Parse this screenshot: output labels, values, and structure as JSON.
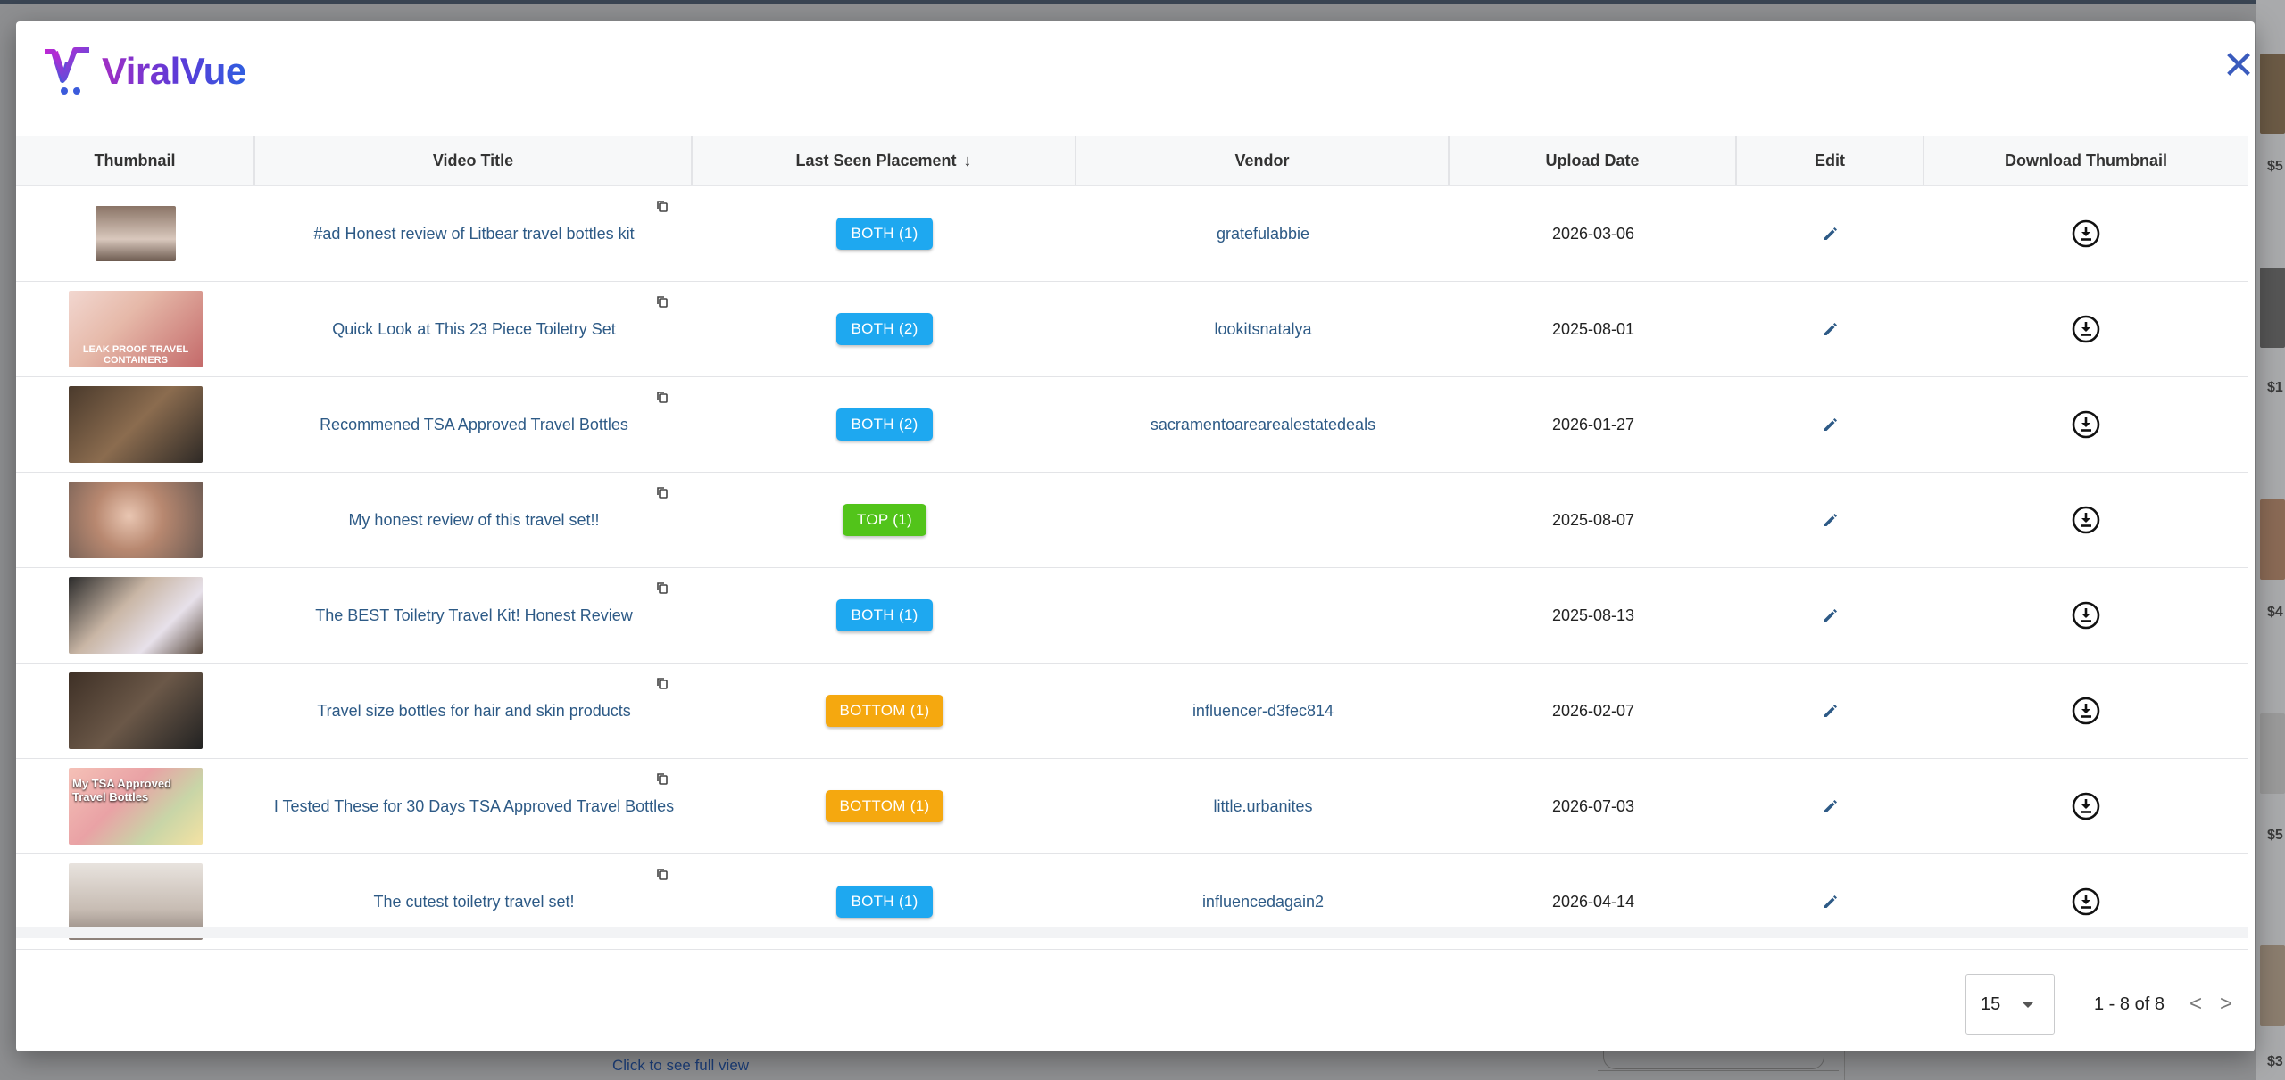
{
  "app": {
    "brand": "ViralVue"
  },
  "colors": {
    "both": "#1ea8f0",
    "top": "#52c41a",
    "bottom": "#f5a80f",
    "link": "#2d5a86",
    "accent": "#3a5bbd"
  },
  "icons": {
    "close": "close-icon",
    "copy": "copy-icon",
    "edit": "pencil-icon",
    "download": "download-circle-icon",
    "sort": "arrow-down-icon"
  },
  "table": {
    "headers": [
      "Thumbnail",
      "Video Title",
      "Last Seen Placement",
      "Vendor",
      "Upload Date",
      "Edit",
      "Download Thumbnail"
    ],
    "rows": [
      {
        "title": "#ad Honest review of Litbear travel bottles kit",
        "placement": "BOTH  (1)",
        "placement_type": "both",
        "vendor": "gratefulabbie",
        "date": "2026-03-06"
      },
      {
        "title": "Quick Look at This 23 Piece Toiletry Set",
        "placement": "BOTH  (2)",
        "placement_type": "both",
        "vendor": "lookitsnatalya",
        "date": "2025-08-01",
        "thumb_text": "LEAK PROOF TRAVEL CONTAINERS"
      },
      {
        "title": "Recommened TSA Approved Travel Bottles",
        "placement": "BOTH  (2)",
        "placement_type": "both",
        "vendor": "sacramentoarearealestatedeals",
        "date": "2026-01-27"
      },
      {
        "title": "My honest review of this travel set!!",
        "placement": "TOP  (1)",
        "placement_type": "top",
        "vendor": "",
        "date": "2025-08-07"
      },
      {
        "title": "The BEST Toiletry Travel Kit! Honest Review",
        "placement": "BOTH  (1)",
        "placement_type": "both",
        "vendor": "",
        "date": "2025-08-13"
      },
      {
        "title": "Travel size bottles for hair and skin products",
        "placement": "BOTTOM  (1)",
        "placement_type": "bottom",
        "vendor": "influencer-d3fec814",
        "date": "2026-02-07"
      },
      {
        "title": "I Tested These for 30 Days TSA Approved Travel Bottles",
        "placement": "BOTTOM  (1)",
        "placement_type": "bottom",
        "vendor": "little.urbanites",
        "date": "2026-07-03",
        "thumb_text": "My TSA Approved Travel Bottles"
      },
      {
        "title": "The cutest toiletry travel set!",
        "placement": "BOTH  (1)",
        "placement_type": "both",
        "vendor": "influencedagain2",
        "date": "2026-04-14"
      }
    ]
  },
  "pagination": {
    "page_size": "15",
    "range": "1 - 8 of 8",
    "prev": "<",
    "next": ">"
  },
  "background": {
    "link": "Click to see full view",
    "prices": [
      "$5",
      "$1",
      "$4",
      "$5",
      "$3"
    ]
  }
}
